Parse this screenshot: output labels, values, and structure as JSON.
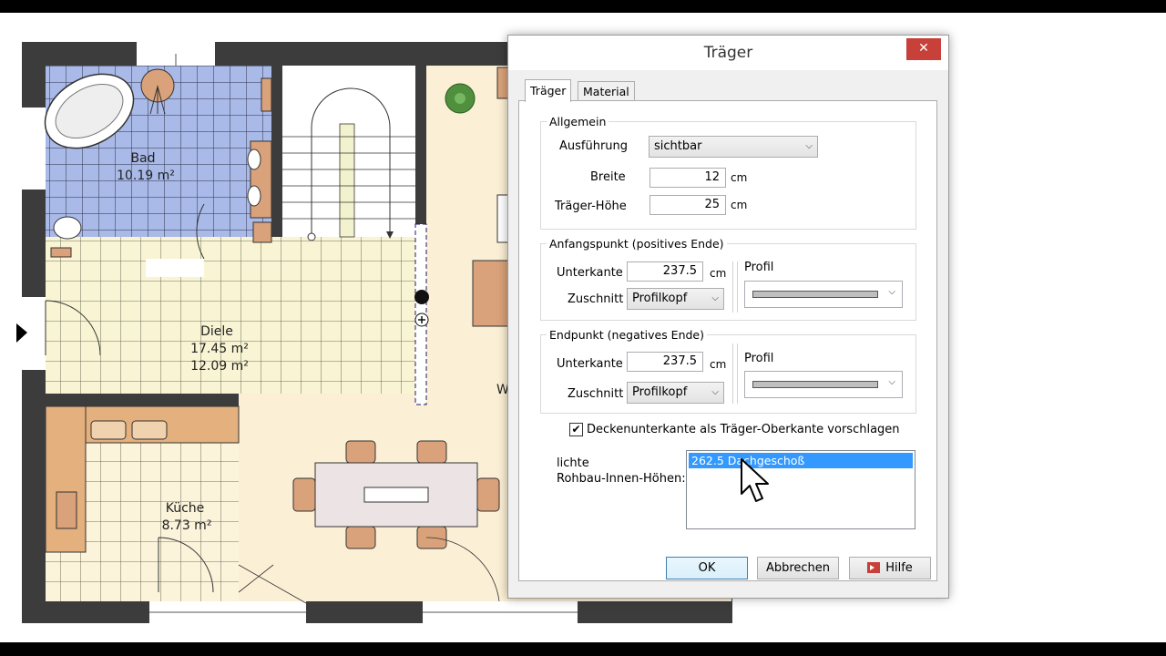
{
  "floorplan": {
    "rooms": [
      {
        "name": "Bad",
        "area": "10.19 m²"
      },
      {
        "name": "Diele",
        "area": "17.45 m²",
        "area2": "12.09 m²"
      },
      {
        "name": "Küche",
        "area": "8.73 m²"
      }
    ],
    "partial_label": "W",
    "colors": {
      "bath_tile": "#a9b9e8",
      "floor_tile": "#f8f4d4",
      "wood": "#fbefd5",
      "wall": "#3c3c3c",
      "furniture": "#d9a27a"
    }
  },
  "dialog": {
    "title": "Träger",
    "close_icon": "close-icon",
    "tabs": [
      {
        "label": "Träger",
        "active": true
      },
      {
        "label": "Material",
        "active": false
      }
    ],
    "allgemein": {
      "legend": "Allgemein",
      "ausfuehrung_label": "Ausführung",
      "ausfuehrung_value": "sichtbar",
      "breite_label": "Breite",
      "breite_value": "12",
      "breite_unit": "cm",
      "hoehe_label": "Träger-Höhe",
      "hoehe_value": "25",
      "hoehe_unit": "cm"
    },
    "anfang": {
      "legend": "Anfangspunkt (positives Ende)",
      "unterkante_label": "Unterkante",
      "unterkante_value": "237.5",
      "unit": "cm",
      "zuschnitt_label": "Zuschnitt",
      "zuschnitt_value": "Profilkopf",
      "profil_label": "Profil"
    },
    "ende": {
      "legend": "Endpunkt (negatives Ende)",
      "unterkante_label": "Unterkante",
      "unterkante_value": "237.5",
      "unit": "cm",
      "zuschnitt_label": "Zuschnitt",
      "zuschnitt_value": "Profilkopf",
      "profil_label": "Profil"
    },
    "checkbox": {
      "label": "Deckenunterkante als Träger-Oberkante vorschlagen",
      "checked": true
    },
    "lichte": {
      "label1": "lichte",
      "label2": "Rohbau-Innen-Höhen:",
      "items": [
        "262.5 Dachgeschoß"
      ]
    },
    "buttons": {
      "ok": "OK",
      "cancel": "Abbrechen",
      "help": "Hilfe"
    },
    "colors": {
      "close_bg": "#c7403a",
      "selection": "#3399ff"
    }
  }
}
